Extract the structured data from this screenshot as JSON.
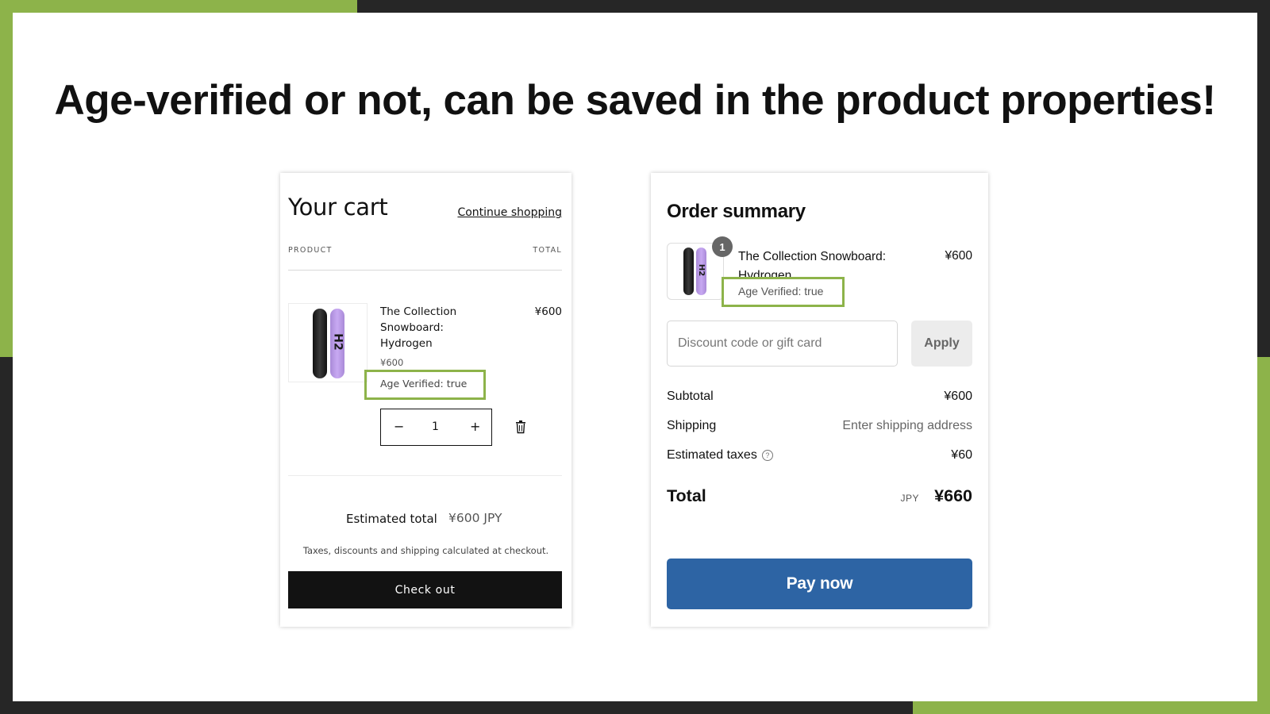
{
  "headline": "Age-verified or not, can be saved in the product properties!",
  "colors": {
    "accent_green": "#8db34a",
    "frame_dark": "#262626",
    "pay_button": "#2d64a4",
    "checkout_button": "#121212"
  },
  "cart": {
    "title": "Your cart",
    "continue_link": "Continue shopping",
    "col_product": "PRODUCT",
    "col_total": "TOTAL",
    "item": {
      "name": "The Collection Snowboard: Hydrogen",
      "line_price": "¥600",
      "unit_price": "¥600",
      "property": "Age Verified: true",
      "quantity": "1",
      "board_mark": "H2"
    },
    "qty_minus": "−",
    "qty_plus": "+",
    "trash_icon": "trash-icon",
    "estimated_total_label": "Estimated total",
    "estimated_total_value": "¥600 JPY",
    "note": "Taxes, discounts and shipping calculated at checkout.",
    "checkout_label": "Check out"
  },
  "summary": {
    "title": "Order summary",
    "item": {
      "badge": "1",
      "name": "The Collection Snowboard: Hydrogen",
      "price": "¥600",
      "property": "Age Verified: true"
    },
    "discount_placeholder": "Discount code or gift card",
    "apply_label": "Apply",
    "subtotal_label": "Subtotal",
    "subtotal_value": "¥600",
    "shipping_label": "Shipping",
    "shipping_value": "Enter shipping address",
    "taxes_label": "Estimated taxes",
    "taxes_help_icon": "?",
    "taxes_value": "¥60",
    "total_label": "Total",
    "total_currency": "JPY",
    "total_value": "¥660",
    "pay_label": "Pay now"
  }
}
